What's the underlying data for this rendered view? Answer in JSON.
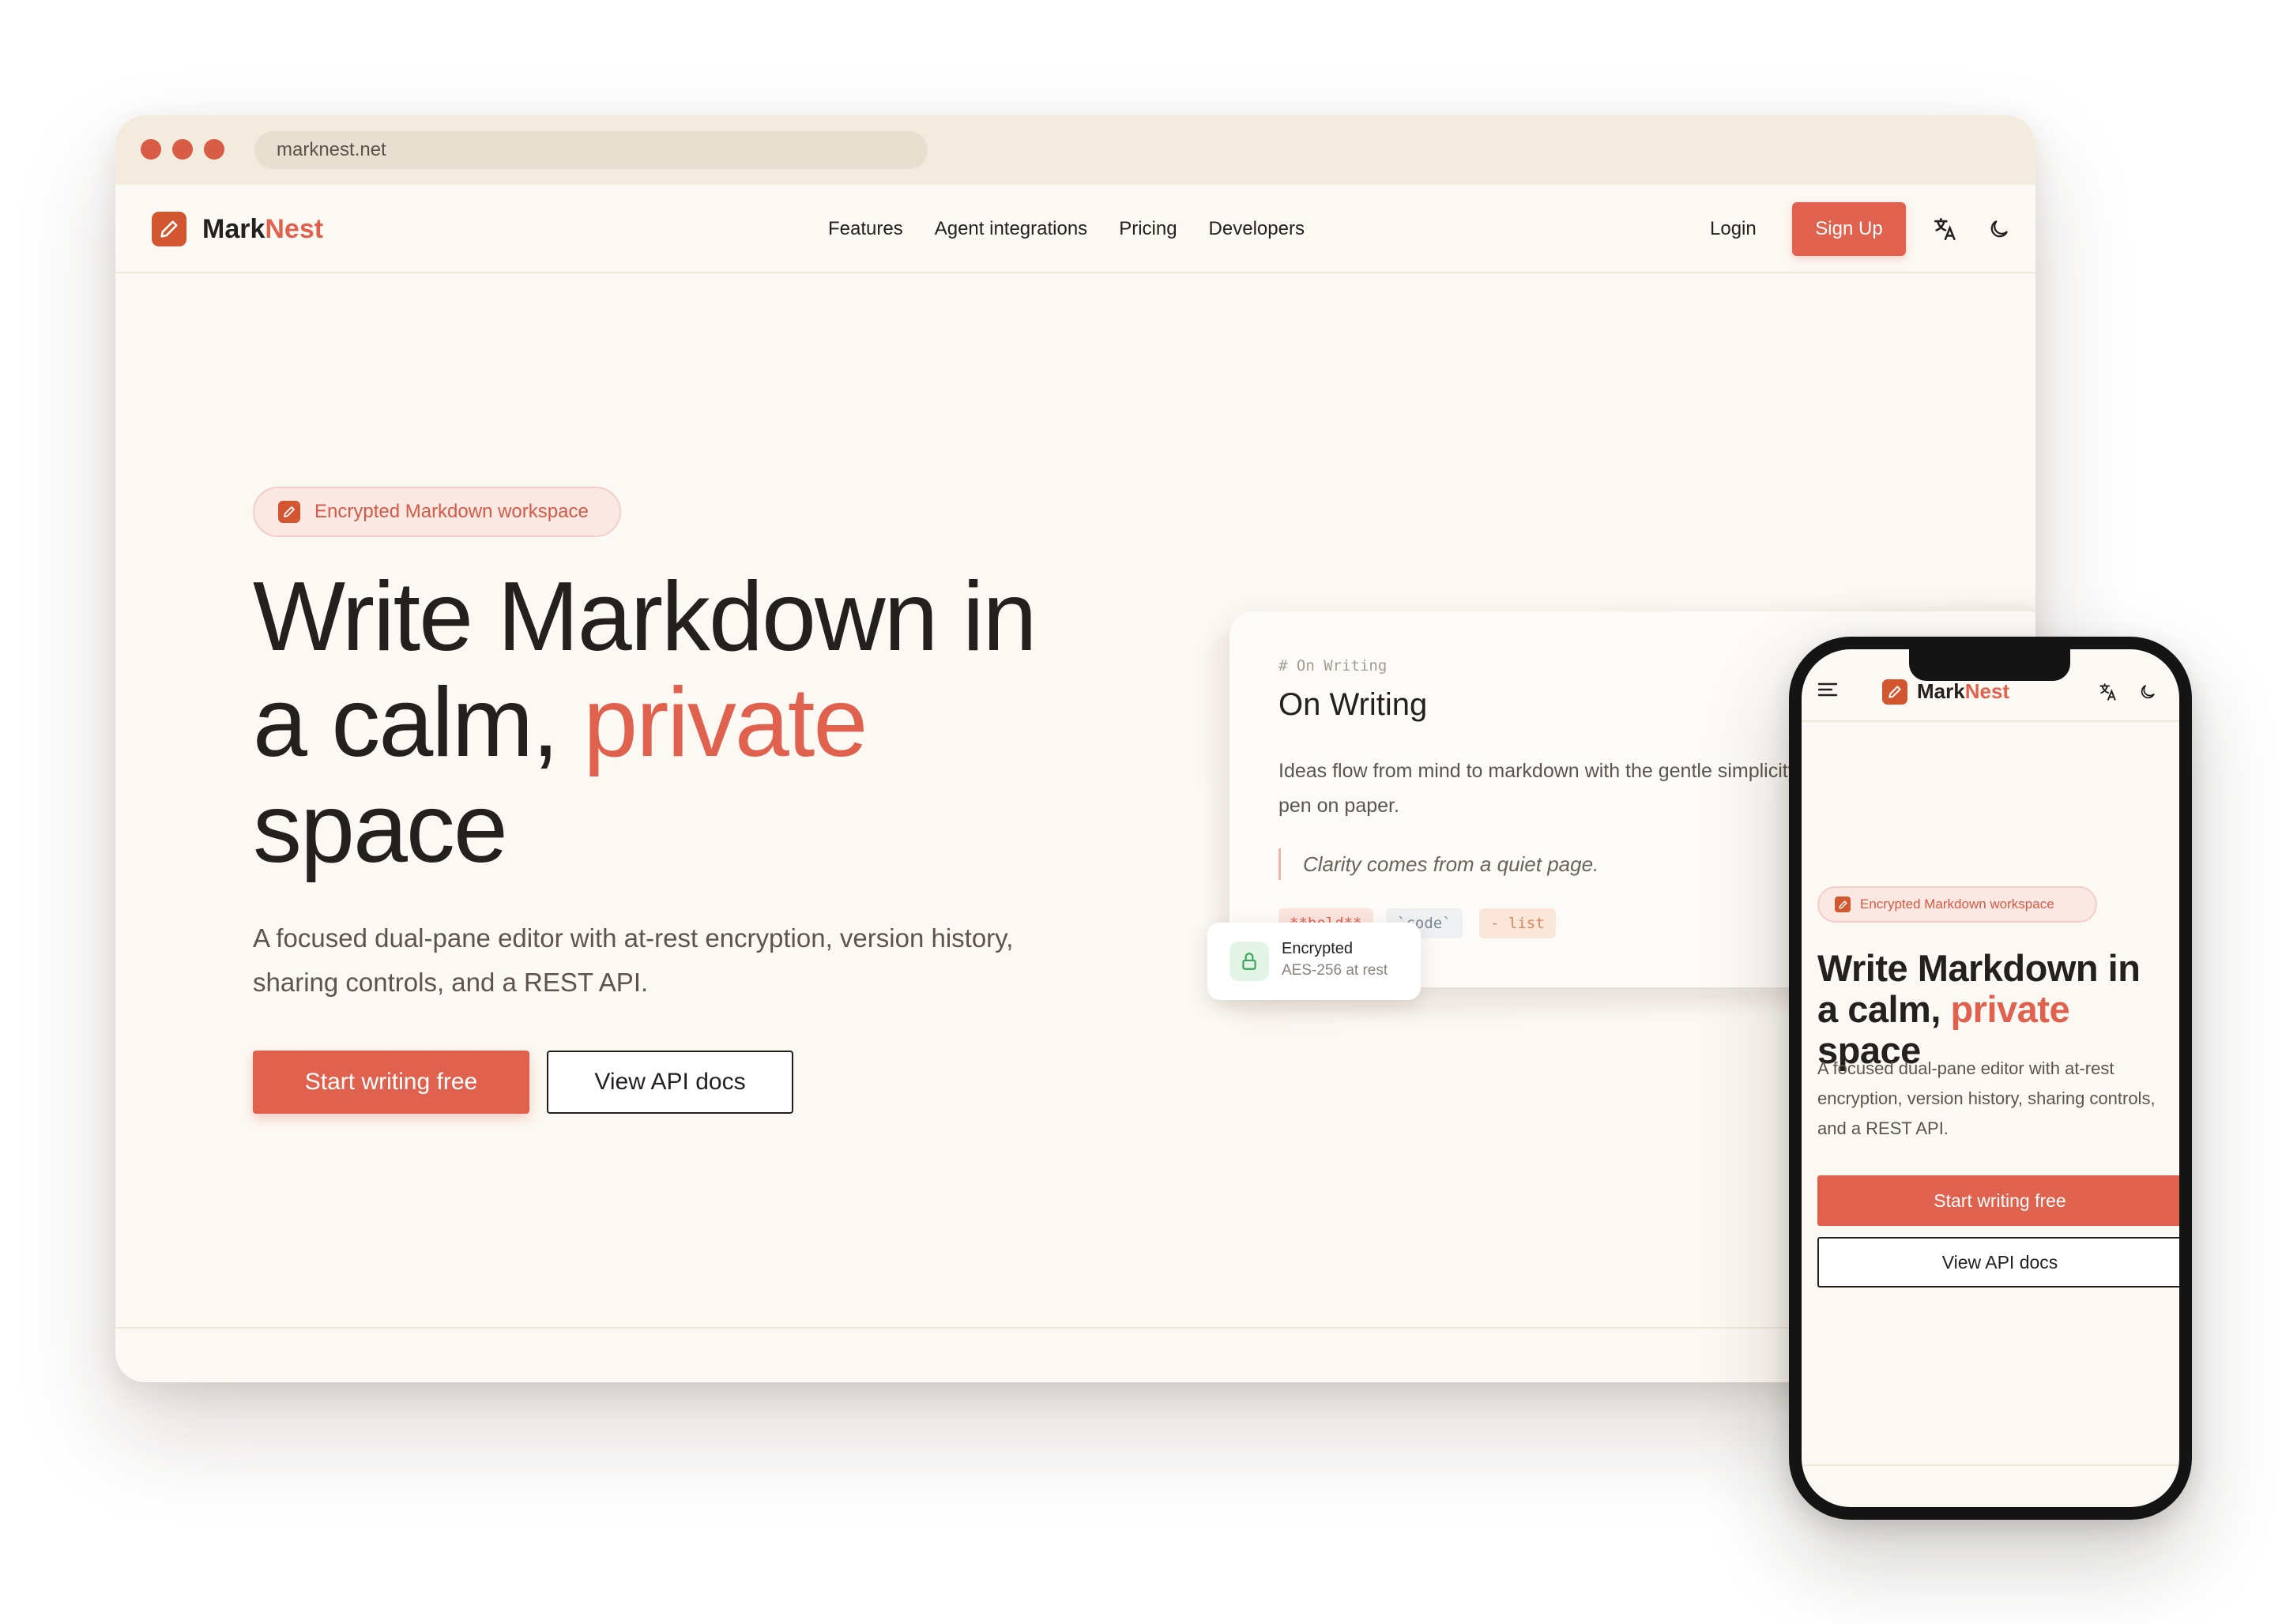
{
  "browser": {
    "url": "marknest.net"
  },
  "brand": {
    "name_part1": "Mark",
    "name_part2": "Nest",
    "logo_icon": "pencil-square-icon",
    "accent_color": "#e0624e"
  },
  "nav": {
    "links": [
      "Features",
      "Agent integrations",
      "Pricing",
      "Developers"
    ],
    "login": "Login",
    "signup": "Sign Up",
    "translate_icon": "translate-icon",
    "theme_icon": "moon-icon"
  },
  "hero": {
    "badge": "Encrypted Markdown workspace",
    "title_line1": "Write Markdown in",
    "title_line2_pre": "a calm,",
    "title_accent": "private",
    "title_line3": "space",
    "subtitle": "A focused dual-pane editor with at-rest encryption, version history, sharing controls, and a REST API.",
    "primary_cta": "Start writing free",
    "secondary_cta": "View API docs"
  },
  "preview": {
    "mono_heading": "# On Writing",
    "title": "On Writing",
    "body": "Ideas flow from mind to markdown with the gentle simplicity of pen on paper.",
    "quote": "Clarity comes from a quiet page.",
    "chips": [
      "**bold**",
      "`code`",
      "- list"
    ],
    "encrypted_title": "Encrypted",
    "encrypted_sub": "AES-256 at rest"
  },
  "mobile": {
    "badge": "Encrypted Markdown workspace",
    "title_pre": "Write Markdown in a calm,",
    "title_accent": "private",
    "title_post": "space",
    "subtitle": "A focused dual-pane editor with at-rest encryption, version history, sharing controls, and a REST API.",
    "primary_cta": "Start writing free",
    "secondary_cta": "View API docs"
  }
}
